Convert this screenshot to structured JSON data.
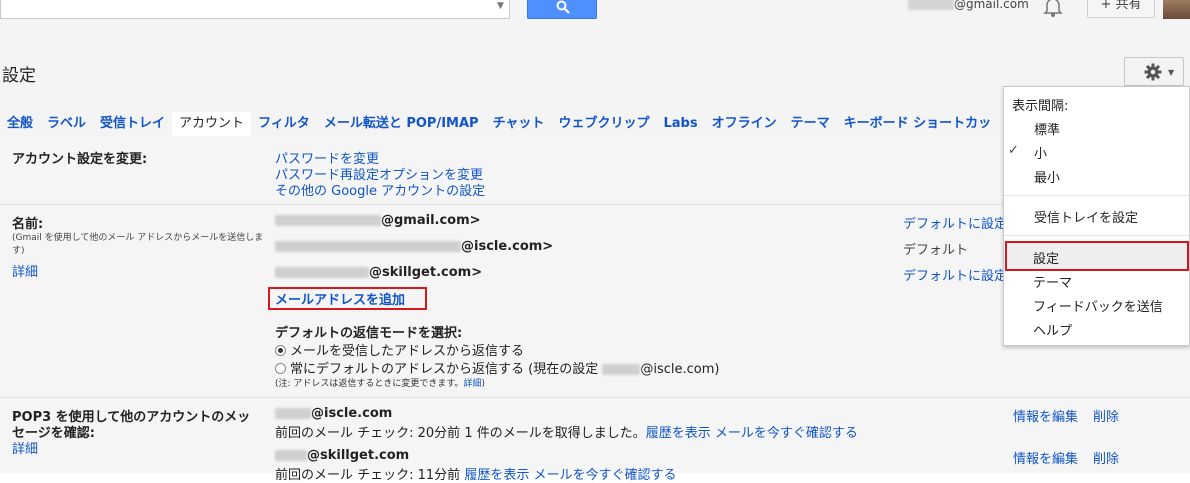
{
  "header": {
    "user_email_suffix": "@gmail.com",
    "share_label": "+ 共有",
    "page_title": "設定"
  },
  "tabs": [
    {
      "label": "全般"
    },
    {
      "label": "ラベル"
    },
    {
      "label": "受信トレイ"
    },
    {
      "label": "アカウント"
    },
    {
      "label": "フィルタ"
    },
    {
      "label": "メール転送と POP/IMAP"
    },
    {
      "label": "チャット"
    },
    {
      "label": "ウェブクリップ"
    },
    {
      "label": "Labs"
    },
    {
      "label": "オフライン"
    },
    {
      "label": "テーマ"
    },
    {
      "label": "キーボード ショートカッ"
    }
  ],
  "account_settings": {
    "label": "アカウント設定を変更:",
    "links": [
      "パスワードを変更",
      "パスワード再設定オプションを変更",
      "その他の Google アカウントの設定"
    ]
  },
  "name": {
    "label": "名前:",
    "hint": "(Gmail を使用して他のメール アドレスからメールを送信します)",
    "detail_link": "詳細",
    "emails": [
      "@gmail.com>",
      "@iscle.com>",
      "@skillget.com>"
    ],
    "right": [
      "デフォルトに設定",
      "デフォルト",
      "デフォルトに設定"
    ],
    "add_email": "メールアドレスを追加",
    "reply_mode_label": "デフォルトの返信モードを選択:",
    "reply_option_1": "メールを受信したアドレスから返信する",
    "reply_option_2_prefix": "常にデフォルトのアドレスから返信する (現在の設定",
    "reply_option_2_suffix": "@iscle.com)",
    "note_text": "(注: アドレスは返信するときに変更できます。",
    "note_link": "詳細",
    "note_close": ")"
  },
  "pop3": {
    "label_line1": "POP3 を使用して他のアカウントのメッ",
    "label_line2": "セージを確認:",
    "detail_link": "詳細",
    "account1": "@iscle.com",
    "account1_status": "前回のメール チェック: 20分前 1 件のメールを取得しました。",
    "history_link": "履歴を表示",
    "check_now_link": "メールを今すぐ確認する",
    "account2": "@skillget.com",
    "account2_status": "前回のメール チェック: 11分前",
    "edit_link": "情報を編集",
    "delete_link": "削除"
  },
  "menu": {
    "density_label": "表示間隔:",
    "density_options": [
      "標準",
      "小",
      "最小"
    ],
    "checked_option": "小",
    "configure_inbox": "受信トレイを設定",
    "settings": "設定",
    "themes": "テーマ",
    "send_feedback": "フィードバックを送信",
    "help": "ヘルプ"
  },
  "colors": {
    "link": "#1155cc",
    "search_button": "#4d90fe",
    "highlight_border": "#d7191f"
  }
}
